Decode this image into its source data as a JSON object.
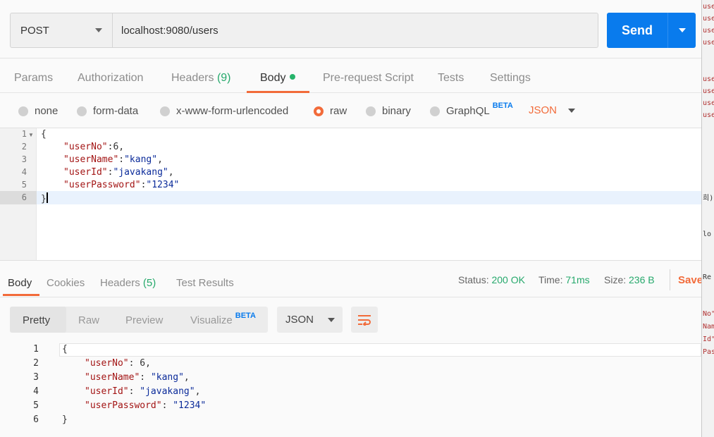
{
  "request": {
    "method": "POST",
    "url": "localhost:9080/users",
    "send_label": "Send"
  },
  "req_tabs": [
    {
      "label": "Params"
    },
    {
      "label": "Authorization"
    },
    {
      "label": "Headers",
      "count": "(9)"
    },
    {
      "label": "Body"
    },
    {
      "label": "Pre-request Script"
    },
    {
      "label": "Tests"
    },
    {
      "label": "Settings"
    }
  ],
  "body_options": {
    "none": "none",
    "form_data": "form-data",
    "urlencoded": "x-www-form-urlencoded",
    "raw": "raw",
    "binary": "binary",
    "graphql": "GraphQL",
    "beta": "BETA",
    "format": "JSON"
  },
  "request_body": {
    "line_numbers": [
      "1",
      "2",
      "3",
      "4",
      "5",
      "6"
    ],
    "lines": [
      {
        "punct": "{"
      },
      {
        "key": "\"userNo\"",
        "sep": ":",
        "val": "6",
        "end": ","
      },
      {
        "key": "\"userName\"",
        "sep": ":",
        "val": "\"kang\"",
        "end": ","
      },
      {
        "key": "\"userId\"",
        "sep": ":",
        "val": "\"javakang\"",
        "end": ","
      },
      {
        "key": "\"userPassword\"",
        "sep": ":",
        "val": "\"1234\"",
        "end": ""
      },
      {
        "punct": "}"
      }
    ]
  },
  "resp_tabs": [
    {
      "label": "Body"
    },
    {
      "label": "Cookies"
    },
    {
      "label": "Headers",
      "count": "(5)"
    },
    {
      "label": "Test Results"
    }
  ],
  "response_meta": {
    "status_label": "Status:",
    "status_value": "200 OK",
    "time_label": "Time:",
    "time_value": "71ms",
    "size_label": "Size:",
    "size_value": "236 B",
    "save_label": "Save"
  },
  "view_modes": {
    "pretty": "Pretty",
    "raw": "Raw",
    "preview": "Preview",
    "visualize": "Visualize",
    "beta": "BETA",
    "format": "JSON"
  },
  "response_body": {
    "line_numbers": [
      "1",
      "2",
      "3",
      "4",
      "5",
      "6"
    ],
    "lines": [
      {
        "punct": "{"
      },
      {
        "key": "\"userNo\"",
        "sep": ": ",
        "val": "6",
        "end": ","
      },
      {
        "key": "\"userName\"",
        "sep": ": ",
        "val": "\"kang\"",
        "end": ","
      },
      {
        "key": "\"userId\"",
        "sep": ": ",
        "val": "\"javakang\"",
        "end": ","
      },
      {
        "key": "\"userPassword\"",
        "sep": ": ",
        "val": "\"1234\"",
        "end": ""
      },
      {
        "punct": "}"
      }
    ]
  },
  "side_panel": {
    "snippets": [
      "use",
      "use",
      "use",
      "use",
      "use",
      "use",
      "use",
      "use",
      "희)",
      "lo",
      "Re",
      "No\"",
      "Nam",
      "Id\"",
      "Pas"
    ]
  },
  "colors": {
    "accent": "#f26b3a",
    "send": "#097bed",
    "success": "#26a96c"
  }
}
